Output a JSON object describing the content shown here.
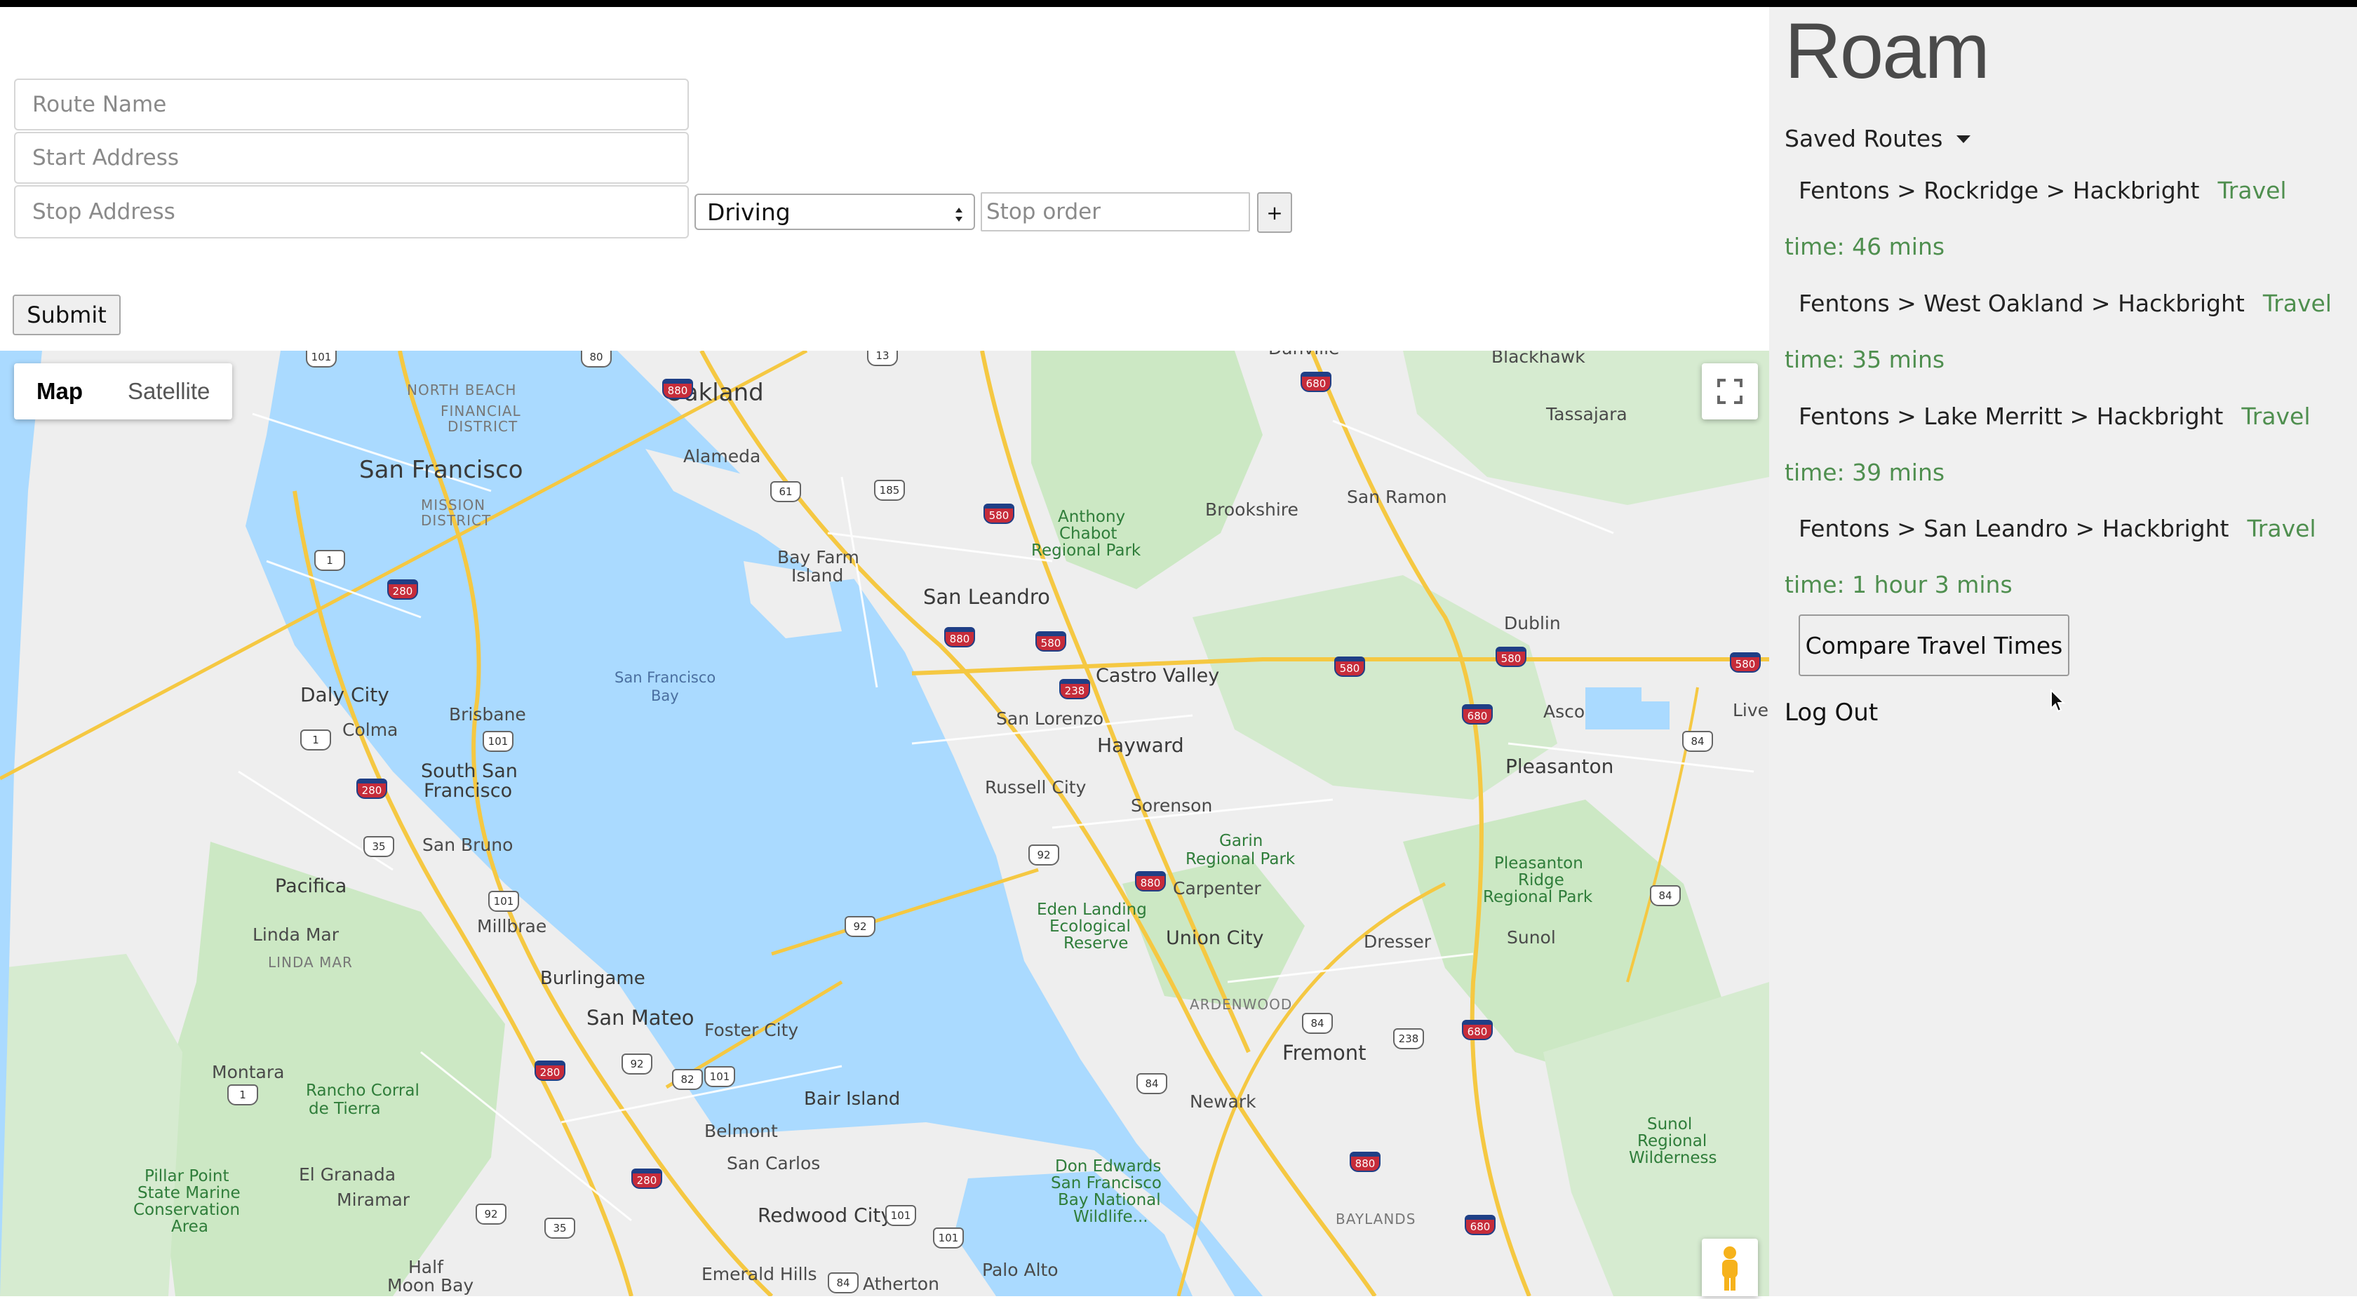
{
  "app": {
    "brand": "Roam"
  },
  "form": {
    "route_name_placeholder": "Route Name",
    "start_address_placeholder": "Start Address",
    "stop_address_placeholder": "Stop Address",
    "travel_mode": "Driving",
    "stop_order_placeholder": "Stop order",
    "add_label": "+",
    "submit_label": "Submit"
  },
  "map": {
    "type_options": [
      "Map",
      "Satellite"
    ],
    "active_type": "Map",
    "places": {
      "oakland": "Oakland",
      "san_francisco": "San Francisco",
      "alameda": "Alameda",
      "north_beach": "NORTH BEACH",
      "financial": "FINANCIAL",
      "district": "DISTRICT",
      "mission": "MISSION",
      "mission_district": "DISTRICT",
      "bay_farm": "Bay Farm",
      "island": "Island",
      "san_leandro": "San Leandro",
      "anthony": "Anthony",
      "chabot": "Chabot",
      "regional_park": "Regional Park",
      "brookshire": "Brookshire",
      "san_ramon": "San Ramon",
      "danville": "Danville",
      "blackhawk": "Blackhawk",
      "tassajara": "Tassajara",
      "dublin": "Dublin",
      "castro_valley": "Castro Valley",
      "sf_bay_1": "San Francisco",
      "sf_bay_2": "Bay",
      "daly_city": "Daly City",
      "brisbane": "Brisbane",
      "colma": "Colma",
      "south_sf_1": "South San",
      "south_sf_2": "Francisco",
      "san_lorenzo": "San Lorenzo",
      "hayward": "Hayward",
      "asco": "Asco",
      "pleasanton": "Pleasanton",
      "livermore": "Liver",
      "russell_city": "Russell City",
      "sorenson": "Sorenson",
      "garin_1": "Garin",
      "garin_2": "Regional Park",
      "san_bruno": "San Bruno",
      "pacifica": "Pacifica",
      "millbrae": "Millbrae",
      "carpenter": "Carpenter",
      "pleasanton_ridge_1": "Pleasanton",
      "pleasanton_ridge_2": "Ridge",
      "pleasanton_ridge_3": "Regional Park",
      "eden_1": "Eden Landing",
      "eden_2": "Ecological",
      "eden_3": "Reserve",
      "linda_mar": "Linda Mar",
      "linda_mar_caps": "LINDA MAR",
      "union_city": "Union City",
      "dresser": "Dresser",
      "sunol": "Sunol",
      "burlingame": "Burlingame",
      "ardenwood": "ARDENWOOD",
      "san_mateo": "San Mateo",
      "foster_city": "Foster City",
      "fremont": "Fremont",
      "montara": "Montara",
      "rancho_1": "Rancho Corral",
      "rancho_2": "de Tierra",
      "bair_island": "Bair Island",
      "newark": "Newark",
      "belmont": "Belmont",
      "sunol_wild_1": "Sunol",
      "sunol_wild_2": "Regional",
      "sunol_wild_3": "Wilderness",
      "pillar_1": "Pillar Point",
      "pillar_2": "State Marine",
      "pillar_3": "Conservation",
      "pillar_4": "Area",
      "el_granada": "El Granada",
      "san_carlos": "San Carlos",
      "don_1": "Don Edwards",
      "don_2": "San Francisco",
      "don_3": "Bay National",
      "don_4": "Wildlife...",
      "miramar": "Miramar",
      "baylands": "BAYLANDS",
      "redwood_city": "Redwood City",
      "half_moon_1": "Half",
      "half_moon_2": "Moon Bay",
      "emerald_hills": "Emerald Hills",
      "atherton": "Atherton",
      "palo_alto": "Palo Alto"
    },
    "shields": {
      "s101a": "101",
      "s80": "80",
      "s880a": "880",
      "s13": "13",
      "s680a": "680",
      "s61": "61",
      "s185": "185",
      "s580a": "580",
      "s1a": "1",
      "s280a": "280",
      "s880b": "880",
      "s580b": "580",
      "s238a": "238",
      "s580c": "580",
      "s580d": "580",
      "s580e": "580",
      "s680b": "680",
      "s1b": "1",
      "s101b": "101",
      "s84a": "84",
      "s280b": "280",
      "s35a": "35",
      "s92a": "92",
      "s880c": "880",
      "s101c": "101",
      "s92b": "92",
      "s84b": "84",
      "s84c": "84",
      "s238b": "238",
      "s280c": "280",
      "s92c": "92",
      "s82": "82",
      "s101d": "101",
      "s680c": "680",
      "s1c": "1",
      "s84d": "84",
      "s880d": "880",
      "s280d": "280",
      "s92d": "92",
      "s101e": "101",
      "s35b": "35",
      "s101f": "101",
      "s84e": "84",
      "s680d": "680"
    }
  },
  "sidebar": {
    "saved_routes_label": "Saved Routes",
    "routes": [
      {
        "name": "Fentons > Rockridge > Hackbright",
        "travel_time": "Travel time: 46 mins"
      },
      {
        "name": "Fentons > West Oakland > Hackbright",
        "travel_time": "Travel time: 35 mins"
      },
      {
        "name": "Fentons > Lake Merritt > Hackbright",
        "travel_time": "Travel time: 39 mins"
      },
      {
        "name": "Fentons > San Leandro > Hackbright",
        "travel_time": "Travel time: 1 hour 3 mins"
      }
    ],
    "compare_label": "Compare Travel Times",
    "logout_label": "Log Out"
  },
  "colors": {
    "water": "#aadaff",
    "land": "#eeeeee",
    "park": "#cce8c4",
    "highway": "#f5c842",
    "travel_time": "#4f8f4f"
  },
  "icons": [
    "fullscreen-icon",
    "pegman-icon",
    "select-arrows-icon",
    "caret-down-icon",
    "mouse-cursor-icon"
  ]
}
